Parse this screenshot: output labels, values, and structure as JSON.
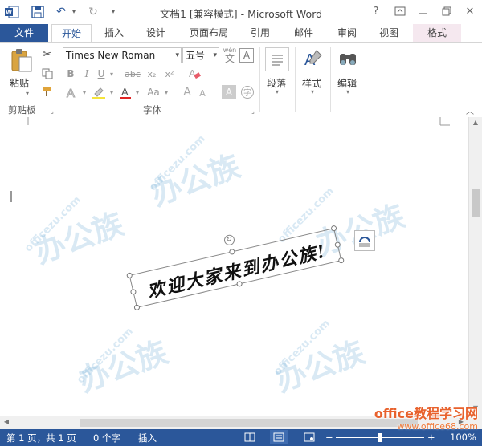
{
  "window": {
    "title": "文档1 [兼容模式] - Microsoft Word",
    "help": "?",
    "minimize": "—",
    "close": "✕"
  },
  "tabs": [
    {
      "label": "文件"
    },
    {
      "label": "开始"
    },
    {
      "label": "插入"
    },
    {
      "label": "设计"
    },
    {
      "label": "页面布局"
    },
    {
      "label": "引用"
    },
    {
      "label": "邮件"
    },
    {
      "label": "审阅"
    },
    {
      "label": "视图"
    },
    {
      "label": "格式"
    }
  ],
  "ribbon": {
    "clipboard": {
      "paste_label": "粘贴",
      "group_label": "剪贴板"
    },
    "font": {
      "font_name": "Times New Roman",
      "font_size": "五号",
      "wen_label": "wén",
      "wen_char": "文",
      "a_box": "A",
      "bold": "B",
      "italic": "I",
      "underline": "U",
      "strike": "abc",
      "sub": "x₂",
      "sup": "x²",
      "aa": "Aa",
      "grow": "A",
      "shrink": "A",
      "group_label": "字体"
    },
    "paragraph": {
      "label": "段落"
    },
    "styles": {
      "label": "样式"
    },
    "editing": {
      "label": "编辑"
    }
  },
  "document": {
    "textbox_text": "欢迎大家来到办公族!"
  },
  "statusbar": {
    "page": "第 1 页，共 1 页",
    "words": "0 个字",
    "mode": "插入",
    "zoom": "100%"
  },
  "watermark": {
    "brand": "办公族",
    "url": "officezu.com",
    "footer_site": "office教程学习网",
    "footer_url": "www.office68.com"
  }
}
